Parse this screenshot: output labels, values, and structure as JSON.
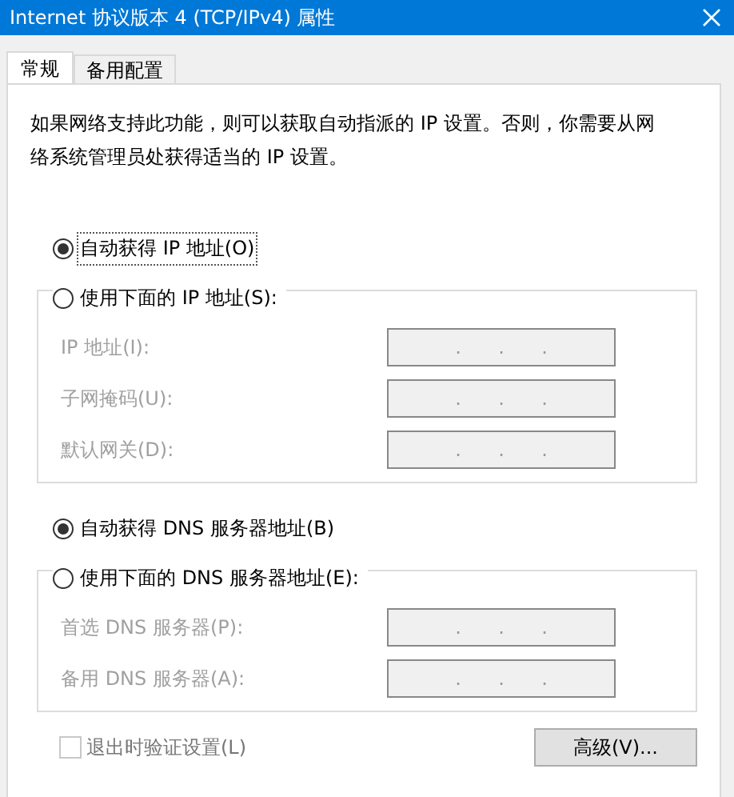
{
  "window": {
    "title": "Internet 协议版本 4 (TCP/IPv4) 属性"
  },
  "tabs": [
    {
      "label": "常规",
      "selected": true
    },
    {
      "label": "备用配置",
      "selected": false
    }
  ],
  "description": "如果网络支持此功能，则可以获取自动指派的 IP 设置。否则，你需要从网络系统管理员处获得适当的 IP 设置。",
  "ip_section": {
    "auto_option": {
      "label": "自动获得 IP 地址(O)",
      "selected": true,
      "focused": true
    },
    "manual_option": {
      "label": "使用下面的 IP 地址(S):",
      "selected": false
    },
    "fields": [
      {
        "label": "IP 地址(I):",
        "disabled": true,
        "separator": "."
      },
      {
        "label": "子网掩码(U):",
        "disabled": true,
        "separator": "."
      },
      {
        "label": "默认网关(D):",
        "disabled": true,
        "separator": "."
      }
    ]
  },
  "dns_section": {
    "auto_option": {
      "label": "自动获得 DNS 服务器地址(B)",
      "selected": true,
      "focused": false
    },
    "manual_option": {
      "label": "使用下面的 DNS 服务器地址(E):",
      "selected": false
    },
    "fields": [
      {
        "label": "首选 DNS 服务器(P):",
        "disabled": true,
        "separator": "."
      },
      {
        "label": "备用 DNS 服务器(A):",
        "disabled": true,
        "separator": "."
      }
    ]
  },
  "validate_checkbox": {
    "label": "退出时验证设置(L)",
    "checked": false,
    "disabled": true
  },
  "advanced_button": "高级(V)..."
}
